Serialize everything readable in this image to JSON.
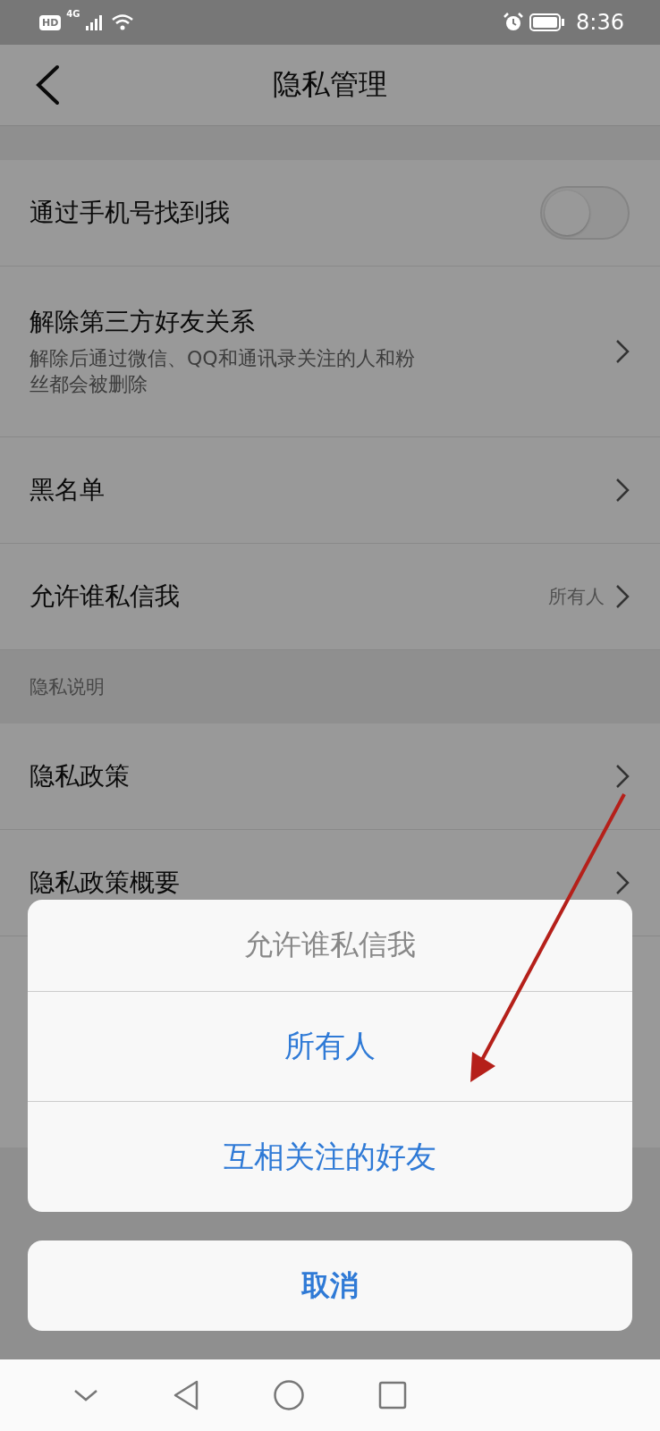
{
  "status_bar": {
    "hd": "HD",
    "network": "4G",
    "time": "8:36"
  },
  "header": {
    "title": "隐私管理"
  },
  "sections": [
    {
      "rows": [
        {
          "kind": "toggle",
          "label": "通过手机号找到我",
          "on": false
        },
        {
          "kind": "link",
          "label": "解除第三方好友关系",
          "description": "解除后通过微信、QQ和通讯录关注的人和粉丝都会被删除"
        },
        {
          "kind": "link",
          "label": "黑名单"
        },
        {
          "kind": "link",
          "label": "允许谁私信我",
          "value": "所有人"
        }
      ]
    },
    {
      "title": "隐私说明",
      "rows": [
        {
          "kind": "link",
          "label": "隐私政策"
        },
        {
          "kind": "link",
          "label": "隐私政策概要"
        }
      ]
    }
  ],
  "action_sheet": {
    "title": "允许谁私信我",
    "options": [
      "所有人",
      "互相关注的好友"
    ],
    "cancel": "取消"
  }
}
